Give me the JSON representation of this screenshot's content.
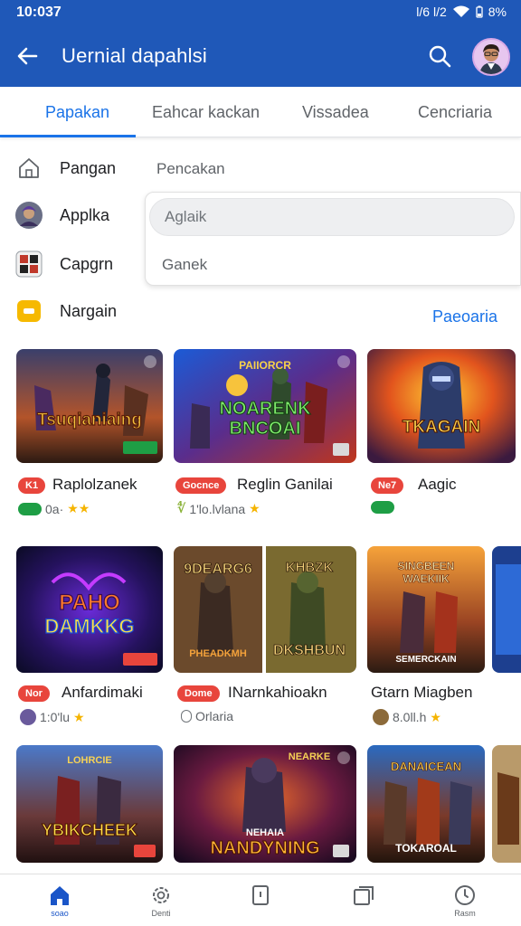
{
  "status": {
    "time": "10:037",
    "signal": "l/6 l/2",
    "battery": "8%"
  },
  "appbar": {
    "title": "Uernial dapahlsi"
  },
  "tabs": [
    {
      "label": "Papakan"
    },
    {
      "label": "Eahcar kackan"
    },
    {
      "label": "Vissadea"
    },
    {
      "label": "Cencriaria"
    }
  ],
  "sidebar": {
    "items": [
      {
        "label": "Pangan",
        "icon": "home-icon"
      },
      {
        "label": "Applka",
        "icon": "avatar-icon"
      },
      {
        "label": "Capgrn",
        "icon": "grid-app-icon"
      },
      {
        "label": "Nargain",
        "icon": "chat-icon"
      }
    ]
  },
  "dropdown": {
    "label": "Pencakan",
    "input_value": "Aglaik",
    "option": "Ganek"
  },
  "more_link": "Paeoaria",
  "games": [
    {
      "art": "Tsuqianiaing",
      "badge": "K1",
      "name": "Raplolzanek",
      "meta": "0a·",
      "rating": "",
      "meta_icon": "green-pill"
    },
    {
      "art_line1": "NOARENK",
      "art_line2": "BNCOAI",
      "art_top": "PAIIORCR",
      "badge": "Gocnce",
      "name": "Reglin Ganilai",
      "meta": "1'lo.lvlana",
      "meta_icon": "leaf-icon"
    },
    {
      "art": "TKAGAIN",
      "badge": "Ne7",
      "name": "Aagic",
      "meta": "",
      "meta_icon": "green-pill"
    },
    {
      "art_line1": "PAHO",
      "art_line2": "DAMKKG",
      "badge": "Nor",
      "name": "Anfardimaki",
      "meta": "1:0'lu",
      "meta_icon": "app-icon"
    },
    {
      "art_left_top": "9DEARG6",
      "art_left_bottom": "PHEADKMH",
      "art_right_top": "KHBZK",
      "art_right_bottom": "DKSHBUN",
      "badge": "Dome",
      "name": "INarnkahioakn",
      "meta": "Orlaria",
      "meta_icon": "circle-icon"
    },
    {
      "art_top": "SINGBEEN",
      "art_mid": "WAEKIIK",
      "art_bottom": "SEMERCKAIN",
      "badge": "",
      "name": "Gtarn Miagben",
      "meta": "8.0ll.h",
      "meta_icon": "app-icon"
    },
    {
      "art_top": "LOHRCIE",
      "art": "YBIKCHEEK",
      "badge": "",
      "name": "",
      "meta": "",
      "meta_icon": ""
    },
    {
      "art_top": "NEARKE",
      "art_sub": "NEHAIA",
      "art": "NANDYNING",
      "badge": "",
      "name": "",
      "meta": "",
      "meta_icon": ""
    },
    {
      "art_top": "DANAICEAN",
      "art_bottom": "TOKAROAL",
      "badge": "",
      "name": "",
      "meta": "",
      "meta_icon": ""
    }
  ],
  "bottom_nav": [
    {
      "label": "soao",
      "icon": "home-icon"
    },
    {
      "label": "Denti",
      "icon": "gear-icon"
    },
    {
      "label": "",
      "icon": "tablet-icon"
    },
    {
      "label": "",
      "icon": "window-icon"
    },
    {
      "label": "Rasm",
      "icon": "clock-icon"
    }
  ],
  "colors": {
    "app_bar": "#1f58b8",
    "accent": "#1a73e8",
    "badge": "#e8453c",
    "star": "#f5b400"
  }
}
